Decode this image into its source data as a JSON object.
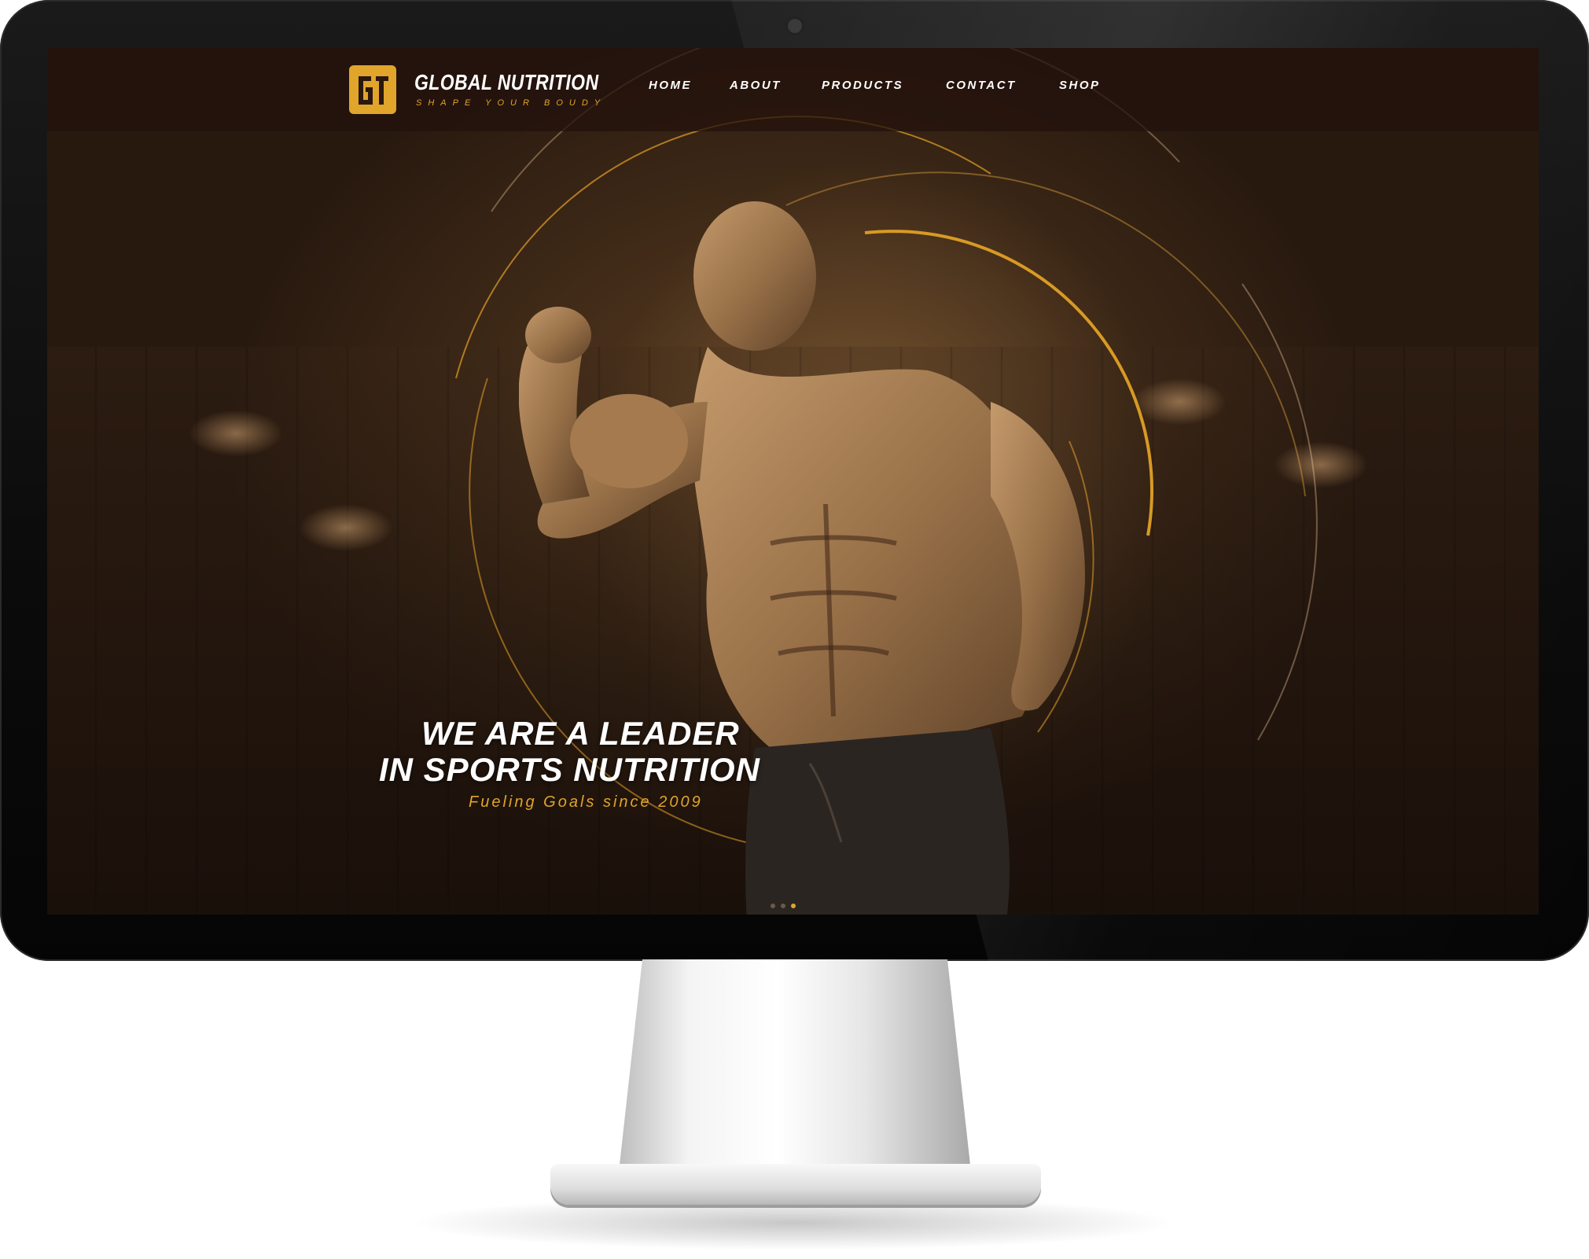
{
  "brand": {
    "name": "GLOBAL NUTRITION",
    "tagline": "SHAPE YOUR BOUDY",
    "logo_mark": "G1",
    "accent_color": "#e0a52a"
  },
  "nav": {
    "items": [
      {
        "label": "HOME"
      },
      {
        "label": "ABOUT"
      },
      {
        "label": "PRODUCTS"
      },
      {
        "label": "CONTACT"
      },
      {
        "label": "SHOP"
      }
    ]
  },
  "hero": {
    "headline_line1": "WE ARE A LEADER",
    "headline_line2": "IN SPORTS NUTRITION",
    "subline": "Fueling Goals since 2009",
    "slides_total": 3,
    "slide_active": 3
  },
  "icons": {
    "logo": "brand-logo-icon",
    "bodybuilder": "hero-bodybuilder-image"
  }
}
